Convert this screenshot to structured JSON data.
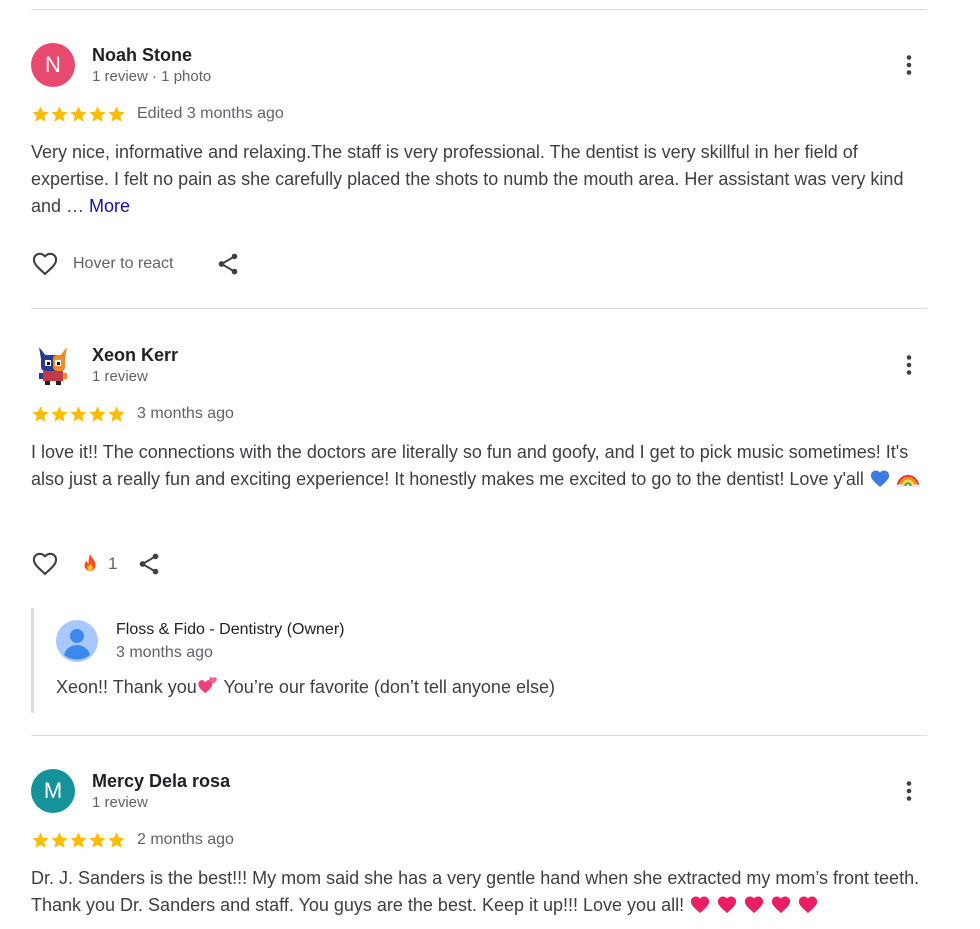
{
  "colors": {
    "star": "#fbbc04",
    "link": "#1a0dab",
    "avatar_n": "#e8496e",
    "avatar_m": "#16939a"
  },
  "reviews": [
    {
      "initial": "N",
      "name": "Noah Stone",
      "meta": "1 review · 1 photo",
      "rating": 5,
      "date": "Edited 3 months ago",
      "text": "Very nice, informative and relaxing.The staff is very professional. The dentist is very skillful in her field of expertise. I felt no pain as she carefully placed the shots to numb the mouth area. Her assistant was very kind and … ",
      "more_label": "More",
      "react_label": "Hover to react"
    },
    {
      "initial": "",
      "name": "Xeon Kerr",
      "meta": "1 review",
      "rating": 5,
      "date": "3 months ago",
      "text": "I love it!! The connections with the doctors are literally so fun and goofy, and I get to pick music sometimes! It's also just a really fun and exciting experience! It honestly makes me excited to go to the dentist! Love y'all ",
      "reaction_count": "1",
      "owner_response": {
        "name": "Floss & Fido - Dentistry (Owner)",
        "date": "3 months ago",
        "text_before": "Xeon!! Thank you",
        "text_after": "  You’re our favorite (don’t tell anyone else)"
      }
    },
    {
      "initial": "M",
      "name": "Mercy Dela rosa",
      "meta": "1 review",
      "rating": 5,
      "date": "2 months ago",
      "text": "Dr. J. Sanders is the best!!! My mom said she has a very gentle hand when she extracted my mom’s front teeth. Thank you Dr. Sanders and staff. You guys are the best. Keep it up!!! Love you all! "
    }
  ]
}
